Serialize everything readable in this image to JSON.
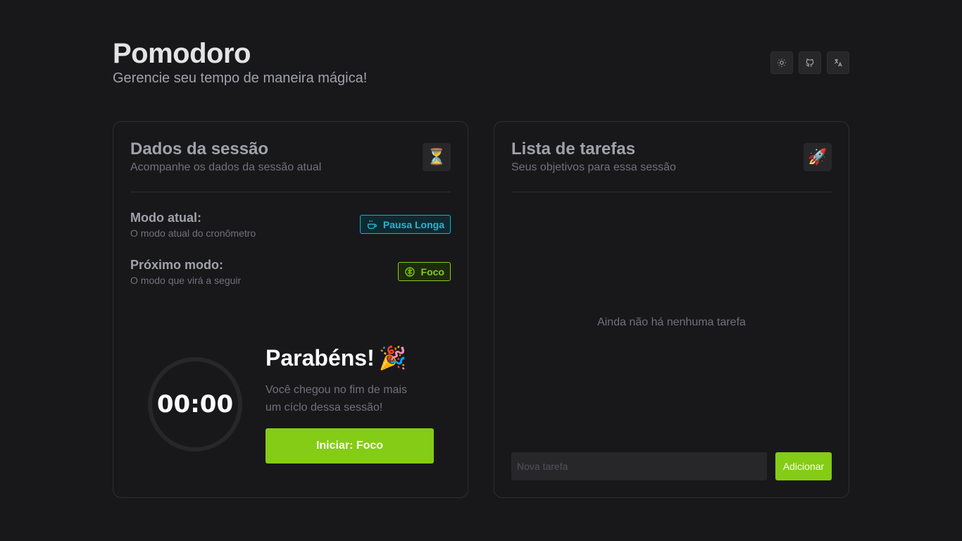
{
  "header": {
    "title": "Pomodoro",
    "subtitle": "Gerencie seu tempo de maneira mágica!",
    "actions": [
      {
        "icon": "sun-icon",
        "label": "theme"
      },
      {
        "icon": "github-icon",
        "label": "github"
      },
      {
        "icon": "translate-icon",
        "label": "language"
      }
    ]
  },
  "session": {
    "title": "Dados da sessão",
    "subtitle": "Acompanhe os dados da sessão atual",
    "badge": "⏳",
    "current_mode": {
      "label": "Modo atual:",
      "description": "O modo atual do cronômetro",
      "value": "Pausa Longa",
      "color": "#06b6d4",
      "icon": "coffee-icon"
    },
    "next_mode": {
      "label": "Próximo modo:",
      "description": "O modo que virá a seguir",
      "value": "Foco",
      "color": "#84cc16",
      "icon": "brain-icon"
    },
    "timer": "00:00",
    "congrats_title": "Parabéns!",
    "congrats_emoji": "🎉",
    "congrats_line1": "Você chegou no fim de mais",
    "congrats_line2": "um cíclo dessa sessão!",
    "start_button": "Iniciar: Foco"
  },
  "tasks": {
    "title": "Lista de tarefas",
    "subtitle": "Seus objetivos para essa sessão",
    "badge": "🚀",
    "empty_message": "Ainda não há nenhuma tarefa",
    "input_placeholder": "Nova tarefa",
    "add_button": "Adicionar"
  },
  "colors": {
    "background": "#18181b",
    "accent": "#84cc16",
    "cyan": "#06b6d4"
  }
}
